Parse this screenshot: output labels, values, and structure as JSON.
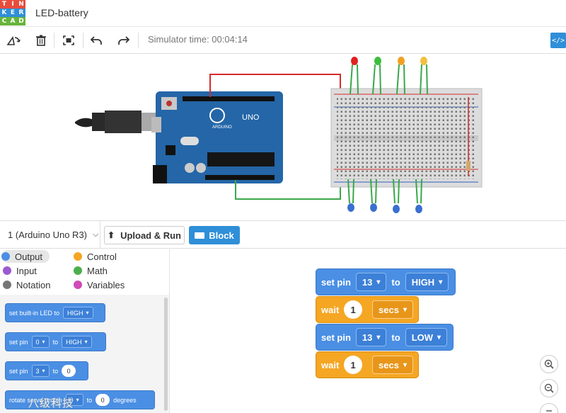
{
  "app": {
    "logo_letters": [
      "T",
      "I",
      "N",
      "K",
      "E",
      "R",
      "C",
      "A",
      "D"
    ],
    "logo_colors": [
      "#e94d3c",
      "#e94d3c",
      "#e94d3c",
      "#2f8fd8",
      "#2f8fd8",
      "#2f8fd8",
      "#68b43a",
      "#68b43a",
      "#68b43a"
    ],
    "project_title": "LED-battery"
  },
  "toolbar": {
    "simulator_time": "Simulator time: 00:04:14",
    "code_toggle": "</>",
    "icons": [
      "rotate-icon",
      "delete-icon",
      "fit-view-icon",
      "undo-icon",
      "redo-icon"
    ]
  },
  "circuit": {
    "board_label": "ARDUINO",
    "board_model": "UNO",
    "led_top_colors": [
      "#e02020",
      "#3cbf3c",
      "#f0a020",
      "#f0c040"
    ],
    "led_bottom_color": "#3a6fd0",
    "wire_red": "#d42b2b",
    "wire_green": "#3aa84a"
  },
  "codebar": {
    "board_select": "1 (Arduino Uno R3)",
    "upload_label": "Upload & Run",
    "block_label": "Block"
  },
  "palette": {
    "categories": [
      {
        "label": "Output",
        "color": "#4a8fe4"
      },
      {
        "label": "Control",
        "color": "#f5a623"
      },
      {
        "label": "Input",
        "color": "#9b59d0"
      },
      {
        "label": "Math",
        "color": "#4cae4c"
      },
      {
        "label": "Notation",
        "color": "#777777"
      },
      {
        "label": "Variables",
        "color": "#d04ab8"
      }
    ],
    "blocks": [
      {
        "pre": "set built-in LED to",
        "dd": "HIGH"
      },
      {
        "pre": "set pin",
        "dd1": "0",
        "mid": "to",
        "dd2": "HIGH"
      },
      {
        "pre": "set pin",
        "dd1": "3",
        "mid": "to",
        "num": "0"
      },
      {
        "pre": "rotate servo on pin",
        "dd1": "0",
        "mid": "to",
        "num": "0",
        "post": "degrees"
      }
    ]
  },
  "workspace": {
    "blocks": [
      {
        "type": "set_pin",
        "label": "set pin",
        "pin": "13",
        "to": "to",
        "state": "HIGH"
      },
      {
        "type": "wait",
        "label": "wait",
        "value": "1",
        "unit": "secs"
      },
      {
        "type": "set_pin",
        "label": "set pin",
        "pin": "13",
        "to": "to",
        "state": "LOW"
      },
      {
        "type": "wait",
        "label": "wait",
        "value": "1",
        "unit": "secs"
      }
    ],
    "zoom_in": "+",
    "zoom_out": "−",
    "zoom_reset": "="
  },
  "watermark": "八级科技"
}
